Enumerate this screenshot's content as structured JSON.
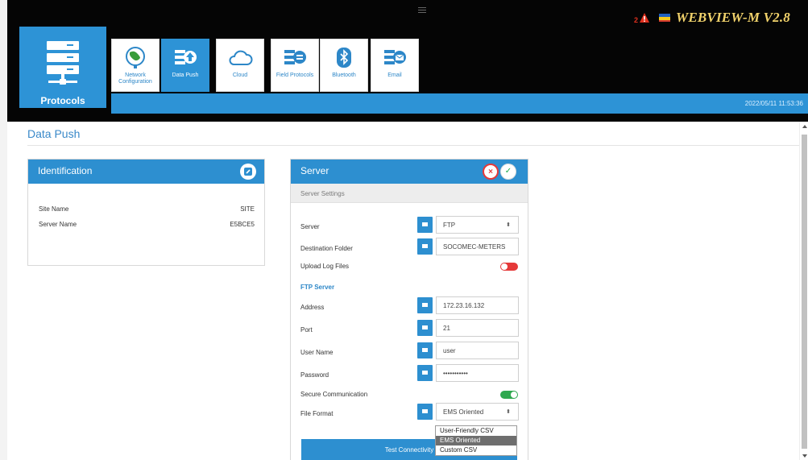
{
  "header": {
    "brand": "WEBVIEW-M V2.8",
    "alert_count": "2",
    "datetime": "2022/05/11 11:53:36",
    "section": "Protocols"
  },
  "nav_tiles": [
    {
      "label": "Network Configuration",
      "icon": "globe-icon"
    },
    {
      "label": "Data Push",
      "icon": "data-push-icon"
    },
    {
      "label": "Cloud",
      "icon": "cloud-icon"
    },
    {
      "label": "Field Protocols",
      "icon": "field-protocols-icon"
    },
    {
      "label": "Bluetooth",
      "icon": "bluetooth-icon"
    },
    {
      "label": "Email",
      "icon": "email-icon"
    }
  ],
  "page": {
    "title": "Data Push"
  },
  "identification": {
    "title": "Identification",
    "rows": [
      {
        "label": "Site Name",
        "value": "SITE"
      },
      {
        "label": "Server Name",
        "value": "E5BCE5"
      }
    ]
  },
  "server": {
    "title": "Server",
    "subtitle": "Server Settings",
    "server_label": "Server",
    "server_value": "FTP",
    "dest_label": "Destination Folder",
    "dest_value": "SOCOMEC-METERS",
    "upload_label": "Upload Log Files",
    "ftp_section": "FTP Server",
    "address_label": "Address",
    "address_value": "172.23.16.132",
    "port_label": "Port",
    "port_value": "21",
    "user_label": "User Name",
    "user_value": "user",
    "password_label": "Password",
    "password_value": "•••••••••••",
    "secure_label": "Secure Communication",
    "format_label": "File Format",
    "format_value": "EMS Oriented",
    "format_options": [
      "User-Friendly CSV",
      "EMS Oriented",
      "Custom CSV"
    ],
    "test_button": "Test Connectivity"
  },
  "colors": {
    "accent": "#2d93d6",
    "toggle_off": "#e53939",
    "toggle_on": "#2fa84f"
  }
}
